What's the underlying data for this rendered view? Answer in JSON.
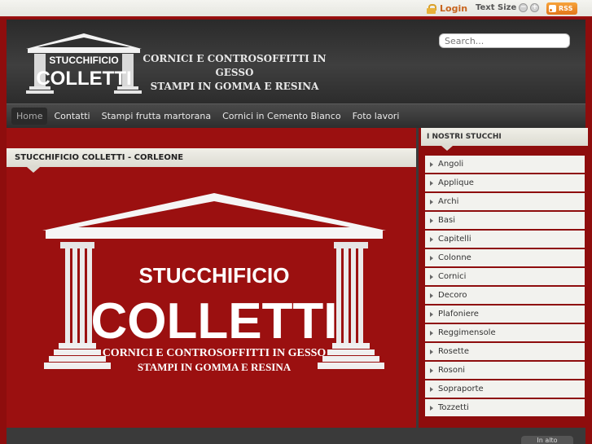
{
  "topbar": {
    "login_label": "Login",
    "text_size_label": "Text Size",
    "decrease": "−",
    "increase": "+",
    "rss_label": "RSS"
  },
  "header": {
    "logo_top": "STUCCHIFICIO",
    "logo_bottom": "COLLETTI",
    "tagline_1": "CORNICI E CONTROSOFFITTI IN GESSO",
    "tagline_2": "STAMPI IN GOMMA  E RESINA",
    "search_placeholder": "Search..."
  },
  "nav": {
    "items": [
      "Home",
      "Contatti",
      "Stampi frutta martorana",
      "Cornici in Cemento Bianco",
      "Foto lavori"
    ]
  },
  "main": {
    "title": "STUCCHIFICIO COLLETTI - CORLEONE",
    "banner_top": "STUCCHIFICIO",
    "banner_bottom": "COLLETTI",
    "banner_line1": "CORNICI E CONTROSOFFITTI IN GESSO",
    "banner_line2": "STAMPI IN GOMMA  E RESINA"
  },
  "sidebar": {
    "title": "I NOSTRI STUCCHI",
    "items": [
      "Angoli",
      "Applique",
      "Archi",
      "Basi",
      "Capitelli",
      "Colonne",
      "Cornici",
      "Decoro",
      "Plafoniere",
      "Reggimensole",
      "Rosette",
      "Rosoni",
      "Sopraporte",
      "Tozzetti"
    ]
  },
  "footer": {
    "top_link": "In alto"
  },
  "colors": {
    "brand_red": "#9b1010",
    "dark": "#2e2e2e",
    "accent_orange": "#c8641e"
  }
}
